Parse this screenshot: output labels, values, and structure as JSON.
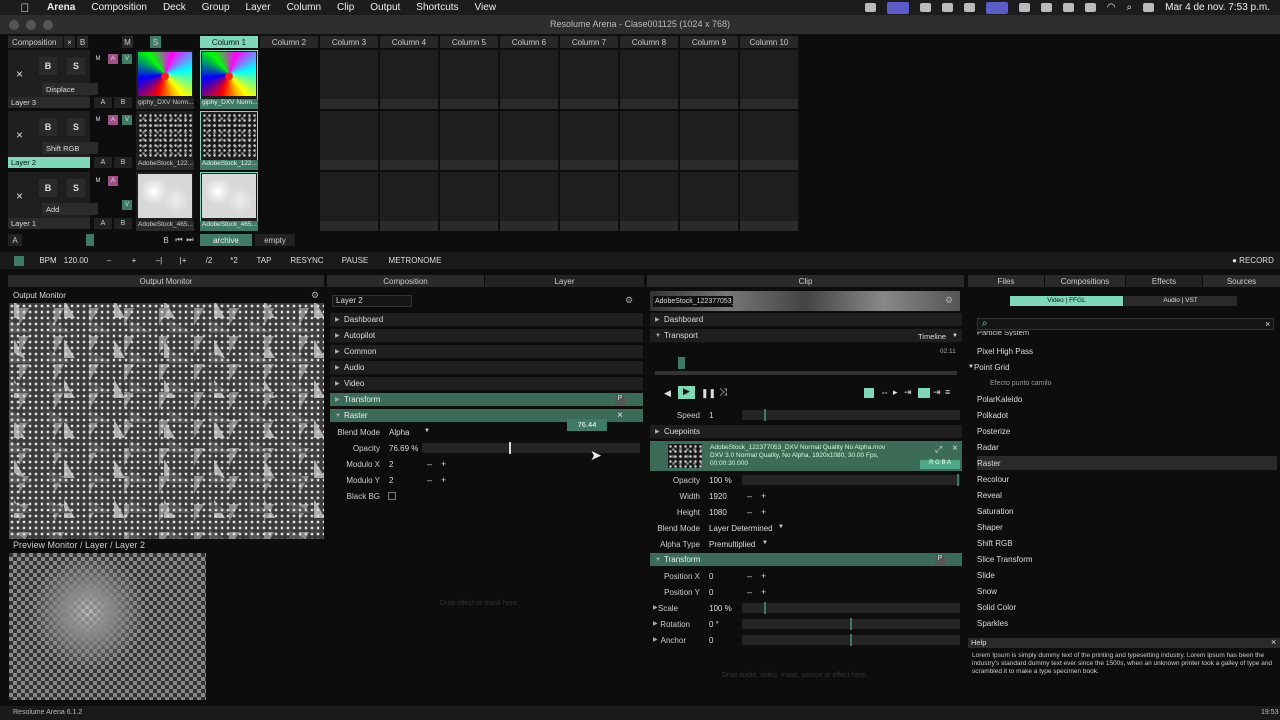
{
  "menubar": {
    "app": "Arena",
    "items": [
      "Composition",
      "Deck",
      "Group",
      "Layer",
      "Column",
      "Clip",
      "Output",
      "Shortcuts",
      "View"
    ],
    "datetime": "Mar 4 de nov.  7:53 p.m."
  },
  "window": {
    "title": "Resolume Arena - Clase001125 (1024 x 768)"
  },
  "composition": {
    "label": "Composition",
    "x": "×",
    "b": "B",
    "m": "M",
    "s": "S",
    "columns": [
      "Column 1",
      "Column 2",
      "Column 3",
      "Column 4",
      "Column 5",
      "Column 6",
      "Column 7",
      "Column 8",
      "Column 9",
      "Column 10"
    ]
  },
  "layers": [
    {
      "name": "Layer 3",
      "blend": "Displace",
      "clips": [
        "giphy_DXV Norm...",
        "giphy_DXV Norm..."
      ]
    },
    {
      "name": "Layer 2",
      "blend": "Shift RGB",
      "clips": [
        "AdobeStock_122...",
        "AdobeStock_122..."
      ]
    },
    {
      "name": "Layer 1",
      "blend": "Add",
      "clips": [
        "AdobeStock_465...",
        "AdobeStock_465..."
      ]
    }
  ],
  "layer_ctrl": {
    "x": "×",
    "b": "B",
    "s": "S",
    "a": "A",
    "bb": "B",
    "mflag": "M",
    "aflag": "A",
    "vflag": "V"
  },
  "deck": {
    "a": "A",
    "b": "B",
    "archive": "archive",
    "empty": "empty"
  },
  "transport": {
    "bpm_label": "BPM",
    "bpm": "120.00",
    "minus": "–",
    "plus": "+",
    "nudge_down": "–|",
    "nudge_up": "|+",
    "half": "/2",
    "double": "*2",
    "tap": "TAP",
    "resync": "RESYNC",
    "pause": "PAUSE",
    "metronome": "METRONOME",
    "record": "● RECORD"
  },
  "panels": {
    "output_monitor": "Output Monitor",
    "output_title": "Output Monitor",
    "preview_title": "Preview Monitor / Layer / Layer 2",
    "composition_tab": "Composition",
    "layer_tab": "Layer",
    "clip_tab": "Clip",
    "files_tab": "Files",
    "compositions_tab": "Compositions",
    "effects_tab": "Effects",
    "sources_tab": "Sources"
  },
  "layer_panel": {
    "name": "Layer 2",
    "sections": [
      "Dashboard",
      "Autopilot",
      "Common",
      "Audio",
      "Video"
    ],
    "transform": "Transform",
    "raster": "Raster",
    "p": "P",
    "tooltip": "76.44",
    "params": [
      {
        "label": "Blend Mode",
        "value": "Alpha"
      },
      {
        "label": "Opacity",
        "value": "76.69 %"
      },
      {
        "label": "Modulo X",
        "value": "2"
      },
      {
        "label": "Modulo Y",
        "value": "2"
      },
      {
        "label": "Black BG",
        "value": ""
      }
    ],
    "drop": "Drop effect or mask here."
  },
  "clip_panel": {
    "name": "AdobeStock_122377053_D...",
    "dashboard": "Dashboard",
    "transport": "Transport",
    "timeline": "Timeline",
    "time": "02.11",
    "speed_label": "Speed",
    "speed": "1",
    "cuepoints": "Cuepoints",
    "file_info": "AdobeStock_122377053_DXV Normal Quality No Alpha.mov",
    "file_info2": "DXV 3.0 Normal Quality, No Alpha, 1920x1080, 30.00 Fps,",
    "file_info3": "00:00:30.000",
    "rgba": "R G B A",
    "params": [
      {
        "label": "Opacity",
        "value": "100 %"
      },
      {
        "label": "Width",
        "value": "1920"
      },
      {
        "label": "Height",
        "value": "1080"
      },
      {
        "label": "Blend Mode",
        "value": "Layer Determined"
      },
      {
        "label": "Alpha Type",
        "value": "Premultiplied"
      }
    ],
    "transform": "Transform",
    "p": "P",
    "tparams": [
      {
        "label": "Position X",
        "value": "0"
      },
      {
        "label": "Position Y",
        "value": "0"
      },
      {
        "label": "Scale",
        "value": "100 %"
      },
      {
        "label": "Rotation",
        "value": "0 °"
      },
      {
        "label": "Anchor",
        "value": "0"
      }
    ],
    "drop": "Drop audio, video, mask, source or effect here."
  },
  "effects": {
    "sub1": "Video | FFGL",
    "sub2": "Audio | VST",
    "cut": "Particle System",
    "items": [
      "Pixel High Pass",
      "Point Grid",
      "Efecto punto camilo",
      "PolarKaleido",
      "Polkadot",
      "Posterize",
      "Radar",
      "Raster",
      "Recolour",
      "Reveal",
      "Saturation",
      "Shaper",
      "Shift RGB",
      "Slice Transform",
      "Slide",
      "Snow",
      "Solid Color",
      "Sparkles"
    ]
  },
  "help": {
    "title": "Help",
    "text": "Lorem Ipsum is simply dummy text of the printing and typesetting industry. Lorem Ipsum has been the industry's standard dummy text ever since the 1500s, when an unknown printer took a galley of type and scrambled it to make a type specimen book."
  },
  "statusbar": {
    "version": "Resolume Arena 6.1.2",
    "clock": "19:53"
  }
}
